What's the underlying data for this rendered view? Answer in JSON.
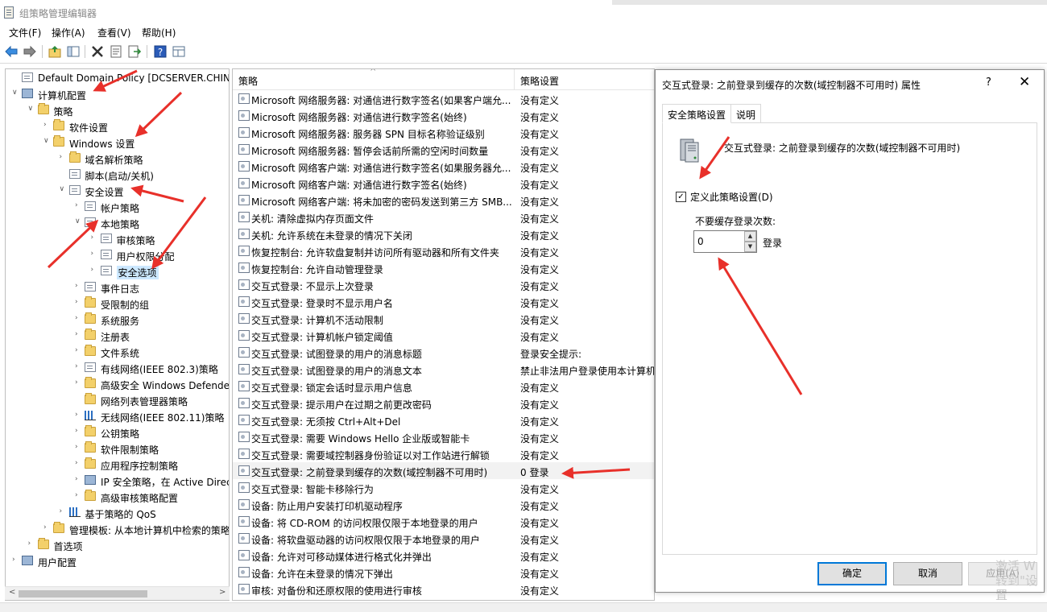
{
  "window": {
    "title": "组策略管理编辑器"
  },
  "menu": [
    "文件(F)",
    "操作(A)",
    "查看(V)",
    "帮助(H)"
  ],
  "toolbar": [
    "back-arrow-icon",
    "forward-arrow-icon",
    "up-folder-icon",
    "show-tree-icon",
    "delete-icon",
    "properties-icon",
    "export-icon",
    "help-icon",
    "view-icon"
  ],
  "tree": [
    {
      "label": "Default Domain Policy [DCSERVER.CHINASK",
      "level": 0,
      "expander": "",
      "icon": "doc"
    },
    {
      "label": "计算机配置",
      "level": 0,
      "expander": "v",
      "icon": "pc"
    },
    {
      "label": "策略",
      "level": 1,
      "expander": "v",
      "icon": "folder"
    },
    {
      "label": "软件设置",
      "level": 2,
      "expander": ">",
      "icon": "folder"
    },
    {
      "label": "Windows 设置",
      "level": 2,
      "expander": "v",
      "icon": "folder"
    },
    {
      "label": "域名解析策略",
      "level": 3,
      "expander": ">",
      "icon": "folder"
    },
    {
      "label": "脚本(启动/关机)",
      "level": 3,
      "expander": "",
      "icon": "doc"
    },
    {
      "label": "安全设置",
      "level": 3,
      "expander": "v",
      "icon": "doc"
    },
    {
      "label": "帐户策略",
      "level": 4,
      "expander": ">",
      "icon": "doc"
    },
    {
      "label": "本地策略",
      "level": 4,
      "expander": "v",
      "icon": "doc"
    },
    {
      "label": "审核策略",
      "level": 5,
      "expander": ">",
      "icon": "doc"
    },
    {
      "label": "用户权限分配",
      "level": 5,
      "expander": ">",
      "icon": "doc"
    },
    {
      "label": "安全选项",
      "level": 5,
      "expander": ">",
      "icon": "doc",
      "selected": true
    },
    {
      "label": "事件日志",
      "level": 4,
      "expander": ">",
      "icon": "doc"
    },
    {
      "label": "受限制的组",
      "level": 4,
      "expander": ">",
      "icon": "folder"
    },
    {
      "label": "系统服务",
      "level": 4,
      "expander": ">",
      "icon": "folder"
    },
    {
      "label": "注册表",
      "level": 4,
      "expander": ">",
      "icon": "folder"
    },
    {
      "label": "文件系统",
      "level": 4,
      "expander": ">",
      "icon": "folder"
    },
    {
      "label": "有线网络(IEEE 802.3)策略",
      "level": 4,
      "expander": ">",
      "icon": "doc"
    },
    {
      "label": "高级安全 Windows Defende",
      "level": 4,
      "expander": ">",
      "icon": "folder"
    },
    {
      "label": "网络列表管理器策略",
      "level": 4,
      "expander": "",
      "icon": "folder"
    },
    {
      "label": "无线网络(IEEE 802.11)策略",
      "level": 4,
      "expander": ">",
      "icon": "chart"
    },
    {
      "label": "公钥策略",
      "level": 4,
      "expander": ">",
      "icon": "folder"
    },
    {
      "label": "软件限制策略",
      "level": 4,
      "expander": ">",
      "icon": "folder"
    },
    {
      "label": "应用程序控制策略",
      "level": 4,
      "expander": ">",
      "icon": "folder"
    },
    {
      "label": "IP 安全策略，在 Active Direc",
      "level": 4,
      "expander": ">",
      "icon": "pc"
    },
    {
      "label": "高级审核策略配置",
      "level": 4,
      "expander": ">",
      "icon": "folder"
    },
    {
      "label": "基于策略的 QoS",
      "level": 3,
      "expander": ">",
      "icon": "chart"
    },
    {
      "label": "管理模板: 从本地计算机中检索的策略",
      "level": 2,
      "expander": ">",
      "icon": "folder"
    },
    {
      "label": "首选项",
      "level": 1,
      "expander": ">",
      "icon": "folder"
    },
    {
      "label": "用户配置",
      "level": 0,
      "expander": ">",
      "icon": "pc"
    }
  ],
  "list": {
    "col_policy": "策略",
    "col_setting": "策略设置",
    "rows": [
      {
        "name": "Microsoft 网络服务器: 对通信进行数字签名(如果客户端允...",
        "value": "没有定义"
      },
      {
        "name": "Microsoft 网络服务器: 对通信进行数字签名(始终)",
        "value": "没有定义"
      },
      {
        "name": "Microsoft 网络服务器: 服务器 SPN 目标名称验证级别",
        "value": "没有定义"
      },
      {
        "name": "Microsoft 网络服务器: 暂停会话前所需的空闲时间数量",
        "value": "没有定义"
      },
      {
        "name": "Microsoft 网络客户端: 对通信进行数字签名(如果服务器允...",
        "value": "没有定义"
      },
      {
        "name": "Microsoft 网络客户端: 对通信进行数字签名(始终)",
        "value": "没有定义"
      },
      {
        "name": "Microsoft 网络客户端: 将未加密的密码发送到第三方 SMB...",
        "value": "没有定义"
      },
      {
        "name": "关机: 清除虚拟内存页面文件",
        "value": "没有定义"
      },
      {
        "name": "关机: 允许系统在未登录的情况下关闭",
        "value": "没有定义"
      },
      {
        "name": "恢复控制台: 允许软盘复制并访问所有驱动器和所有文件夹",
        "value": "没有定义"
      },
      {
        "name": "恢复控制台: 允许自动管理登录",
        "value": "没有定义"
      },
      {
        "name": "交互式登录: 不显示上次登录",
        "value": "没有定义"
      },
      {
        "name": "交互式登录: 登录时不显示用户名",
        "value": "没有定义"
      },
      {
        "name": "交互式登录: 计算机不活动限制",
        "value": "没有定义"
      },
      {
        "name": "交互式登录: 计算机帐户锁定阈值",
        "value": "没有定义"
      },
      {
        "name": "交互式登录: 试图登录的用户的消息标题",
        "value": "登录安全提示:"
      },
      {
        "name": "交互式登录: 试图登录的用户的消息文本",
        "value": "禁止非法用户登录使用本计算机"
      },
      {
        "name": "交互式登录: 锁定会话时显示用户信息",
        "value": "没有定义"
      },
      {
        "name": "交互式登录: 提示用户在过期之前更改密码",
        "value": "没有定义"
      },
      {
        "name": "交互式登录: 无须按 Ctrl+Alt+Del",
        "value": "没有定义"
      },
      {
        "name": "交互式登录: 需要 Windows Hello 企业版或智能卡",
        "value": "没有定义"
      },
      {
        "name": "交互式登录: 需要域控制器身份验证以对工作站进行解锁",
        "value": "没有定义"
      },
      {
        "name": "交互式登录: 之前登录到缓存的次数(域控制器不可用时)",
        "value": "0 登录",
        "selected": true
      },
      {
        "name": "交互式登录: 智能卡移除行为",
        "value": "没有定义"
      },
      {
        "name": "设备: 防止用户安装打印机驱动程序",
        "value": "没有定义"
      },
      {
        "name": "设备: 将 CD-ROM 的访问权限仅限于本地登录的用户",
        "value": "没有定义"
      },
      {
        "name": "设备: 将软盘驱动器的访问权限仅限于本地登录的用户",
        "value": "没有定义"
      },
      {
        "name": "设备: 允许对可移动媒体进行格式化并弹出",
        "value": "没有定义"
      },
      {
        "name": "设备: 允许在未登录的情况下弹出",
        "value": "没有定义"
      },
      {
        "name": "审核: 对备份和还原权限的使用进行审核",
        "value": "没有定义"
      }
    ]
  },
  "dialog": {
    "title": "交互式登录: 之前登录到缓存的次数(域控制器不可用时) 属性",
    "help": "?",
    "close": "✕",
    "tab_security": "安全策略设置",
    "tab_explain": "说明",
    "heading": "交互式登录: 之前登录到缓存的次数(域控制器不可用时)",
    "define_checkbox": "定义此策略设置(D)",
    "define_checked": true,
    "cache_label": "不要缓存登录次数:",
    "cache_value": "0",
    "cache_unit": "登录",
    "ok": "确定",
    "cancel": "取消",
    "apply": "应用(A)"
  },
  "watermark": {
    "line1": "激活 W",
    "line2": "转到\"设置"
  },
  "colors": {
    "annotation": "#e8302a",
    "selection": "#cce8ff",
    "primary_button_border": "#0078d7"
  }
}
